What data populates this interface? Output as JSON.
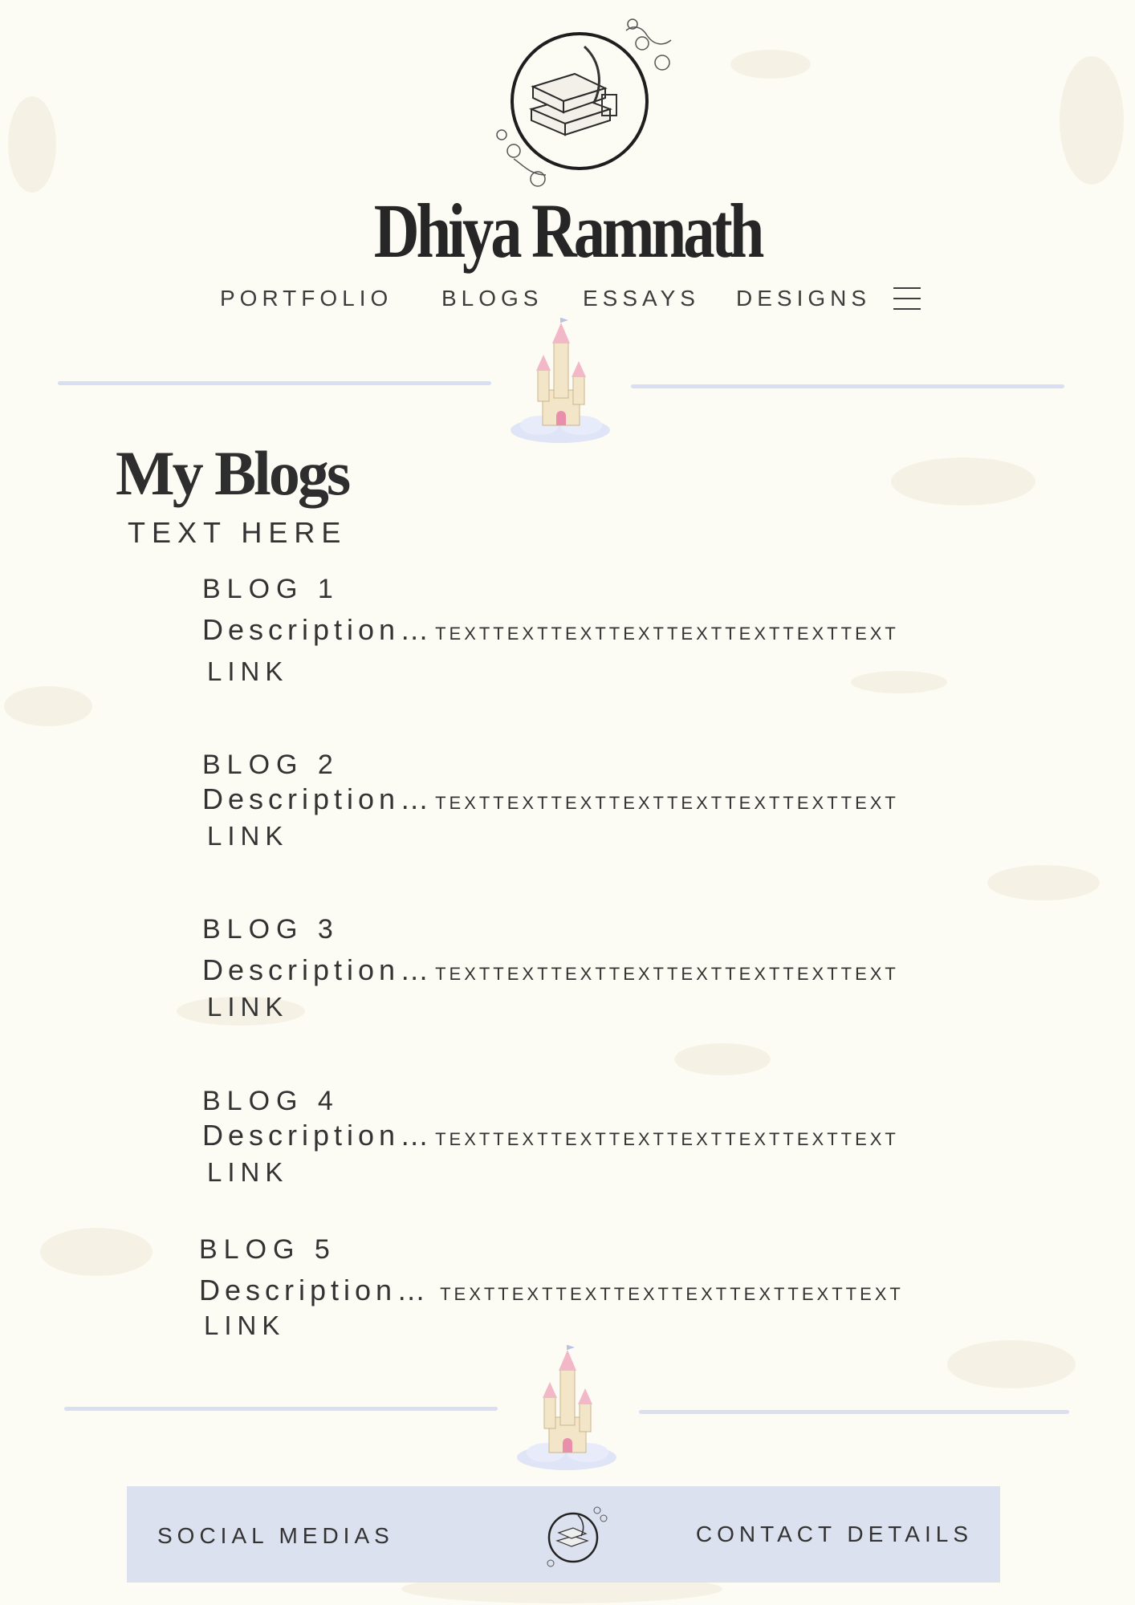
{
  "site": {
    "name": "Dhiya Ramnath"
  },
  "nav": {
    "items": [
      {
        "label": "PORTFOLIO"
      },
      {
        "label": "BLOGS"
      },
      {
        "label": "ESSAYS"
      },
      {
        "label": "DESIGNS"
      }
    ],
    "menu_icon": "hamburger-menu-icon"
  },
  "main": {
    "title": "My Blogs",
    "subtitle": "TEXT HERE",
    "blogs": [
      {
        "title": "BLOG 1",
        "description": "Description…",
        "description_text": "TEXTTEXTTEXTTEXTTEXTTEXTTEXTTEXT",
        "link": "LINK"
      },
      {
        "title": "BLOG 2",
        "description": "Description…",
        "description_text": "TEXTTEXTTEXTTEXTTEXTTEXTTEXTTEXT",
        "link": "LINK"
      },
      {
        "title": "BLOG 3",
        "description": "Description…",
        "description_text": "TEXTTEXTTEXTTEXTTEXTTEXTTEXTTEXT",
        "link": "LINK"
      },
      {
        "title": "BLOG 4",
        "description": "Description…",
        "description_text": "TEXTTEXTTEXTTEXTTEXTTEXTTEXTTEXT",
        "link": "LINK"
      },
      {
        "title": "BLOG 5",
        "description": "Description…",
        "description_text": "TEXTTEXTTEXTTEXTTEXTTEXTTEXTTEXT",
        "link": "LINK"
      }
    ]
  },
  "footer": {
    "social_label": "SOCIAL MEDIAS",
    "contact_label": "CONTACT DETAILS"
  },
  "colors": {
    "background": "#fdfcf4",
    "divider": "#d9dff2",
    "footer_bg": "#dce1ef",
    "text": "#333333"
  },
  "icons": [
    "books-quill-logo-icon",
    "castle-cloud-icon",
    "hamburger-menu-icon"
  ]
}
